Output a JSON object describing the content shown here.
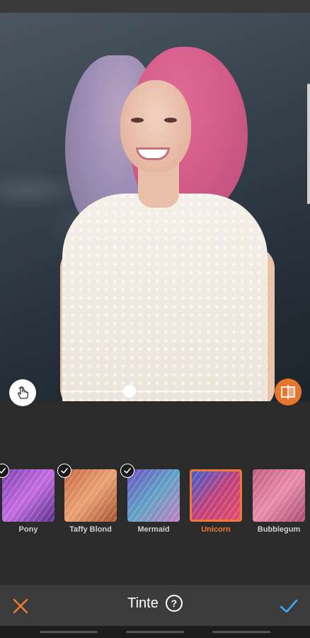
{
  "colors": {
    "accent": "#EE7A35",
    "confirm": "#3FA9F5",
    "bar_background": "#3B3B3B",
    "panel_background": "#2B2B2B"
  },
  "photo": {
    "description_icon_left": "touch-hand-icon",
    "description_icon_right": "compare-split-icon",
    "intensity_level": 0.34
  },
  "swatches": [
    {
      "label": "Pony",
      "applied": true,
      "selected": false,
      "colors": [
        "#7b3fb0",
        "#c26be0",
        "#5a2d88"
      ]
    },
    {
      "label": "Taffy Blond",
      "applied": true,
      "selected": false,
      "colors": [
        "#c8643f",
        "#e9a070",
        "#a7502f"
      ]
    },
    {
      "label": "Mermaid",
      "applied": true,
      "selected": false,
      "colors": [
        "#6a4fc4",
        "#5fa0c4",
        "#c07fc0"
      ]
    },
    {
      "label": "Unicorn",
      "applied": false,
      "selected": true,
      "colors": [
        "#3a5fd0",
        "#c0407a",
        "#e34b6b"
      ]
    },
    {
      "label": "Bubblegum",
      "applied": false,
      "selected": false,
      "colors": [
        "#c05a80",
        "#e88aa8",
        "#a84b70"
      ]
    }
  ],
  "bottom_bar": {
    "title": "Tinte",
    "help_symbol": "?",
    "close_icon": "close-icon",
    "confirm_icon": "check-icon"
  }
}
